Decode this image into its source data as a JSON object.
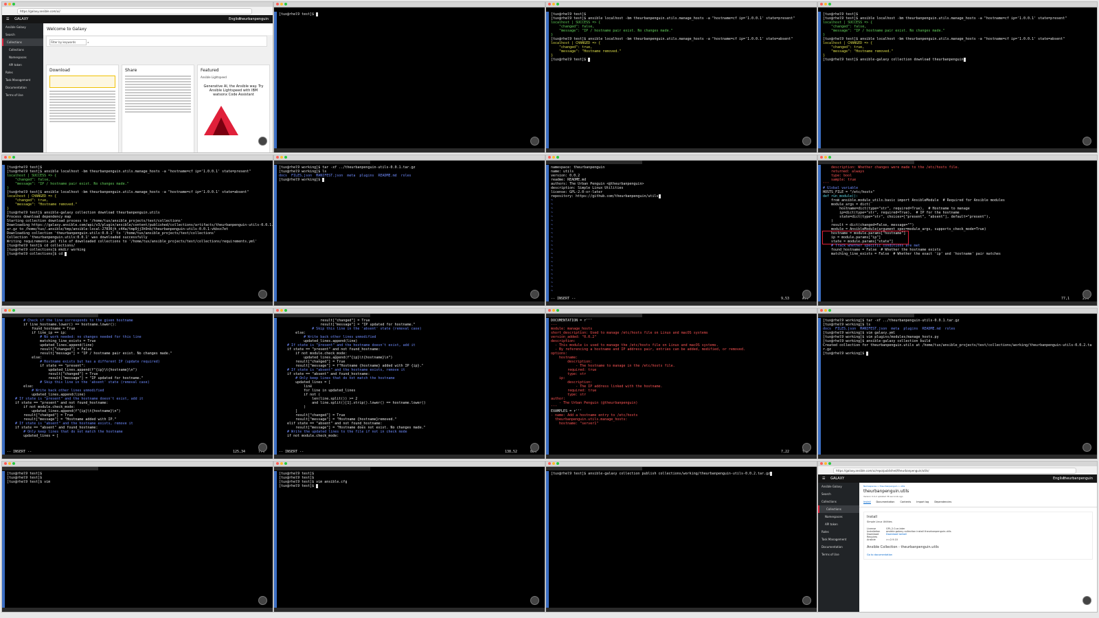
{
  "colors": {
    "terminal_bg": "#000000",
    "prompt": "#e6e6e6",
    "green": "#63d05a",
    "yellow": "#dede4a",
    "red": "#ff5555",
    "blue": "#6f8cff",
    "highlight": "#e0203a"
  },
  "panel1": {
    "url": "https://galaxy.ansible.com/ui/",
    "header_brand": "GALAXY",
    "header_lang": "English",
    "header_user": "theurbanpenguin",
    "sidebar": [
      "Ansible Galaxy",
      "Search",
      "Collections",
      "Collections",
      "Namespaces",
      "API token",
      "Roles",
      "Task Management",
      "Documentation",
      "Terms of Use"
    ],
    "welcome": "Welcome to Galaxy",
    "search_placeholder": "Filter by keywords",
    "cards": [
      "Download",
      "Share",
      "Featured"
    ],
    "featured_sub": "Ansible Lightspeed",
    "featured_ad": "Generative AI, the Ansible way. Try Ansible Lightspeed with IBM watsonx Code Assistant"
  },
  "panel2": {
    "lines": [
      "[tux@rhel9 test]$ "
    ]
  },
  "panel3": {
    "lines": [
      "[tux@rhel9 test]$",
      "[tux@rhel9 test]$ ansible localhost -bm theurbanpenguin.utils.manage_hosts -a \"hostname=cf ip='1.0.0.1' state=present\"",
      "localhost | SUCCESS => {",
      "    \"changed\": false,",
      "    \"message\": \"IP / hostname pair exist. No changes made.\"",
      "}",
      "[tux@rhel9 test]$ ansible localhost -bm theurbanpenguin.utils.manage_hosts -a \"hostname=cf ip='1.0.0.1' state=absent\"",
      "localhost | CHANGED => {",
      "    \"changed\": true,",
      "    \"message\": \"Hostname removed.\"",
      "}",
      "[tux@rhel9 test]$ "
    ]
  },
  "panel4": {
    "lines": [
      "[tux@rhel9 test]$",
      "[tux@rhel9 test]$ ansible localhost -bm theurbanpenguin.utils.manage_hosts -a \"hostname=cf ip='1.0.0.1' state=present\"",
      "localhost | SUCCESS => {",
      "    \"changed\": false,",
      "    \"message\": \"IP / hostname pair exist. No changes made.\"",
      "}",
      "[tux@rhel9 test]$ ansible localhost -bm theurbanpenguin.utils.manage_hosts -a \"hostname=cf ip='1.0.0.1' state=absent\"",
      "localhost | CHANGED => {",
      "    \"changed\": true,",
      "    \"message\": \"Hostname removed.\"",
      "}",
      "[tux@rhel9 test]$ ansible-galaxy collection download theurbanpenguin"
    ]
  },
  "panel5": {
    "lines": [
      "[tux@rhel9 test]$",
      "[tux@rhel9 test]$ ansible localhost -bm theurbanpenguin.utils.manage_hosts -a \"hostname=cf ip='1.0.0.1' state=present\"",
      "localhost | SUCCESS => {",
      "    \"changed\": false,",
      "    \"message\": \"IP / hostname pair exist. No changes made.\"",
      "}",
      "[tux@rhel9 test]$ ansible localhost -bm theurbanpenguin.utils.manage_hosts -a \"hostname=cf ip='1.0.0.1' state=absent\"",
      "localhost | CHANGED => {",
      "    \"changed\": true,",
      "    \"message\": \"Hostname removed.\"",
      "}",
      "[tux@rhel9 test]$ ansible-galaxy collection download theurbanpenguin.utils",
      "Process download dependency map",
      "Starting collection download process to '/home/tux/ansible_projects/test/collections'",
      "Downloading https://galaxy.ansible.com/api/v3/plugin/ansible/content/published/collections/artifacts/theurbanpenguin-utils-0.0.1.t",
      "ar.gz to /home/tux/.ansible/tmp/ansible-local-27836jh_c44a/tmp9jj3h9nb/theurbanpenguin-utils-0.0.1-vkbsx7et",
      "Downloading collection 'theurbanpenguin.utils:0.0.1' to '/home/tux/ansible_projects/test/collections'",
      "Collection 'theurbanpenguin.utils:0.0.1' was downloaded successfully",
      "Writing requirements.yml file of downloaded collections to '/home/tux/ansible_projects/test/collections/requirements.yml'",
      "[tux@rhel9 test]$ cd collections/",
      "[tux@rhel9 collections]$ mkdir working",
      "[tux@rhel9 collections]$ cd "
    ]
  },
  "panel6": {
    "lines": [
      "[tux@rhel9 working]$ tar -xf ../theurbanpenguin-utils-0.0.1.tar.gz",
      "[tux@rhel9 working]$ ls",
      "docs  FILES.json  MANIFEST.json  meta  plugins  README.md  roles",
      "[tux@rhel9 working]$ "
    ]
  },
  "panel7": {
    "lines": [
      "namespace: theurbanpenguin",
      "name: utils",
      "version: 0.0.2",
      "readme: README.md",
      "authors: The Urban Penguin <@theurbanpenguin>",
      "description: Simple Linux Utilities",
      "license: GPL-2.0-or-later",
      "repository: https://github.com/theurbanpenguin/utils"
    ],
    "mode": "-- INSERT --",
    "pos": "9,53",
    "pct": "All"
  },
  "panel8": {
    "lines": [
      "    description: Whether changes were made to the /etc/hosts file.",
      "    returned: always",
      "    type: bool",
      "    sample: true",
      "'''",
      "",
      "# Global variable",
      "HOSTS_FILE = \"/etc/hosts\"",
      "",
      "",
      "def run_module():",
      "    from ansible.module_utils.basic import AnsibleModule  # Required for Ansible modules",
      "",
      "    module_args = dict(",
      "        hostname=dict(type=\"str\", required=True),  # Hostname to manage",
      "        ip=dict(type=\"str\", required=True),  # IP for the hostname",
      "        state=dict(type=\"str\", choices=[\"present\", \"absent\"], default=\"present\"),",
      "    )",
      "",
      "    result = dict(changed=False, message=\"\")",
      "",
      "    module = AnsibleModule(argument_spec=module_args, supports_check_mode=True)",
      "",
      "    hostname = module.params[\"hostname\"]",
      "    ip = module.params[\"ip\"]",
      "    state = module.params[\"state\"]",
      "",
      "    # Track whether specific conditions are met",
      "    found_hostname = False  # Whether the hostname exists",
      "    matching_line_exists = False  # Whether the exact 'ip' and 'hostname' pair matches"
    ],
    "pos": "77,1",
    "pct": "29%"
  },
  "panel9": {
    "lines": [
      "        # Check if the line corresponds to the given hostname",
      "        if line_hostname.lower() == hostname.lower():",
      "            found_hostname = True",
      "            if line_ip == ip:",
      "                # No work needed: no changes needed for this line",
      "                matching_line_exists = True",
      "                updated_lines.append(line)",
      "                result[\"changed\"] = False",
      "                result[\"message\"] = \"IP / hostname pair exist. No changes made.\"",
      "            else:",
      "                # Hostname exists but has a different IP (update required)",
      "                if state == \"present\":",
      "                    updated_lines.append(f\"{ip}\\t{hostname}\\n\")",
      "                    result[\"changed\"] = True",
      "                    result[\"message\"] = \"IP updated for hostname.\"",
      "                # Skip this line in the 'absent' state (removal case)",
      "        else:",
      "            # Write back other lines unmodified",
      "            updated_lines.append(line)",
      "",
      "    # If state is \"present\" and the hostname doesn't exist, add it",
      "    if state == \"present\" and not found_hostname:",
      "        if not module.check_mode:",
      "            updated_lines.append(f\"{ip}\\t{hostname}\\n\")",
      "        result[\"changed\"] = True",
      "        result[\"message\"] = \"Hostname added with IP.\"",
      "",
      "    # If state is \"absent\" and the hostname exists, remove it",
      "    if state == \"absent\" and found_hostname:",
      "        # Only keep lines that do not match the hostname",
      "        updated_lines = ["
    ],
    "mode": "-- INSERT --",
    "pos": "125,34",
    "pct": "77%"
  },
  "panel10": {
    "lines": [
      "                    result[\"changed\"] = True",
      "                    result[\"message\"] = \"IP updated for hostname.\"",
      "                # Skip this line in the 'absent' state (removal case)",
      "        else:",
      "            # Write back other lines unmodified",
      "            updated_lines.append(line)",
      "",
      "    # If state is \"present\" and the hostname doesn't exist, add it",
      "    if state == \"present\" and not found_hostname:",
      "        if not module.check_mode:",
      "            updated_lines.append(f\"{ip}\\t{hostname}\\n\")",
      "        result[\"changed\"] = True",
      "        result[\"message\"] = f\"Hostname {hostname} added with IP {ip}.\"",
      "",
      "    # If state is \"absent\" and the hostname exists, remove it",
      "    if state == \"absent\" and found_hostname:",
      "        # Only keep lines that do not match the hostname",
      "        updated_lines = [",
      "            line",
      "            for line in updated_lines",
      "            if not (",
      "                len(line.split()) >= 2",
      "                and line.split()[1].strip().lower() == hostname.lower()",
      "            )",
      "        ]",
      "        result[\"changed\"] = True",
      "        result[\"message\"] = \"Hostname {hostname}removed.\"",
      "    elif state == \"absent\" and not found_hostname:",
      "        result[\"message\"] = \"Hostname does not exist. No changes made.\"",
      "",
      "    # Write the updated lines to the file if not in check mode",
      "    if not module.check_mode:"
    ],
    "mode": "-- INSERT --",
    "pos": "138,52",
    "pct": "88%"
  },
  "panel11": {
    "lines": [
      "DOCUMENTATION = r'''",
      "---",
      "module: manage_hosts",
      "",
      "short_description: Used to manage /etc/hosts file on Linux and macOS systems",
      "",
      "version_added: \"0.0.2\"",
      "",
      "description:",
      "  - This module is used to manage the /etc/hosts file on Linux and macOS systems.",
      "  - By referencing a hostname and IP address pair, entries can be added, modified, or removed.",
      "",
      "options:",
      "    hostname:",
      "        description:",
      "            - The hostname to manage in the /etc/hosts file.",
      "        required: true",
      "        type: str",
      "    ip:",
      "        description:",
      "            - The IP address linked with the hostname.",
      "        required: true",
      "        type: str",
      "",
      "author:",
      "    - The Urban Penguin (@theurbanpenguin)",
      "'''",
      "",
      "EXAMPLES = r'''",
      "- name: Add a hostname entry to /etc/hosts",
      "  theurbanpenguin.utils.manage_hosts:",
      "    hostname: \"server1\""
    ],
    "pos": "7,22",
    "pct": "Top"
  },
  "panel12": {
    "lines": [
      "[tux@rhel9 working]$ tar -xf ../theurbanpenguin-utils-0.0.1.tar.gz",
      "[tux@rhel9 working]$ ls",
      "docs  FILES.json  MANIFEST.json  meta  plugins  README.md  roles",
      "[tux@rhel9 working]$ vim galaxy.yml",
      "[tux@rhel9 working]$ vim plugins/modules/manage_hosts.py",
      "[tux@rhel9 working]$ ansible-galaxy collection build",
      "Created collection for theurbanpenguin.utils at /home/tux/ansible_projects/test/collections/working/theurbanpenguin-utils-0.0.2.ta",
      "r.gz",
      "[tux@rhel9 working]$ "
    ]
  },
  "panel13": {
    "lines": [
      "[tux@rhel9 test]$",
      "[tux@rhel9 test]$",
      "[tux@rhel9 test]$ vim"
    ]
  },
  "panel14": {
    "lines": [
      "[tux@rhel9 test]$",
      "[tux@rhel9 test]$",
      "[tux@rhel9 test]$ vim ansible.cfg",
      "[tux@rhel9 test]$ "
    ]
  },
  "panel15": {
    "lines": [
      "[tux@rhel9 test]$ ansible-galaxy collection publish collections/working/theurbanpenguin-utils-0.0.2.tar.gz"
    ]
  },
  "panel16": {
    "url": "https://galaxy.ansible.com/ui/repo/published/theurbanpenguin/utils/",
    "header_brand": "GALAXY",
    "header_lang": "English",
    "header_user": "theurbanpenguin",
    "breadcrumb": "Namespaces  >  theurbanpenguin  >  utils",
    "title": "theurbanpenguin.utils",
    "version": "Version 0.0.2 updated 36 seconds ago",
    "tabs": [
      "Install",
      "Documentation",
      "Contents",
      "Import log",
      "Dependencies"
    ],
    "install_heading": "Install",
    "desc": "Simple Linux Utilities",
    "license_label": "License",
    "license": "GPL-2.0-or-later",
    "installation_label": "Installation",
    "install_cmd": "ansible-galaxy collection install theurbanpenguin.utils",
    "download_label": "Download",
    "download_link": "Download tarball",
    "requires_label": "Requires Ansible",
    "requires": ">=2.9.10",
    "section": "Ansible Collection - theurbanpenguin.utils",
    "docs_link": "Go to documentation",
    "sidebar": [
      "Ansible Galaxy",
      "Search",
      "Collections",
      "Collections",
      "Namespaces",
      "API token",
      "Roles",
      "Task Management",
      "Documentation",
      "Terms of Use"
    ]
  }
}
